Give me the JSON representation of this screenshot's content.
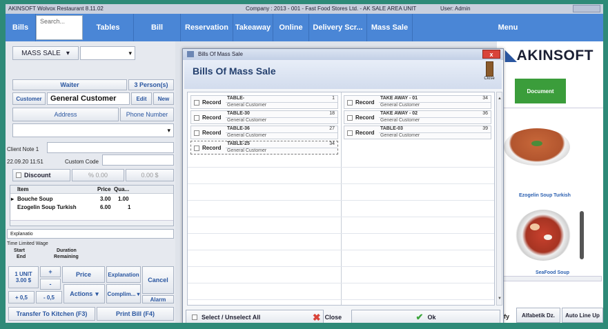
{
  "window": {
    "title": "AKINSOFT Wolvox Restaurant 8.11.02",
    "company": "Company : 2013 - 001 - Fast Food Stores Ltd.  -  AK SALE AREA UNIT",
    "user": "User: Admin"
  },
  "nav": {
    "bills": "Bills",
    "search_placeholder": "Search...",
    "tables": "Tables",
    "bill": "Bill",
    "reservation": "Reservation",
    "takeaway": "Takeaway",
    "online": "Online",
    "delivery": "Delivery Scr...",
    "mass_sale": "Mass Sale",
    "menu": "Menu"
  },
  "left": {
    "mode": "MASS SALE",
    "waiter_label": "Waiter",
    "persons": "3 Person(s)",
    "customer_btn": "Customer",
    "customer_name": "General Customer",
    "edit_btn": "Edit",
    "new_btn": "New",
    "address_btn": "Address",
    "phone_btn": "Phone Number",
    "client_note": "Client Note 1",
    "datetime": "22.09.20 11:51",
    "custom_code": "Custom Code",
    "discount_label": "Discount",
    "discount_pct": "% 0.00",
    "discount_amt": "0.00 $",
    "grid_headers": {
      "item": "Item",
      "price": "Price",
      "qty": "Qua..."
    },
    "items": [
      {
        "item": "Bouche Soup",
        "price": "3.00",
        "qty": "1.00"
      },
      {
        "item": "Ezogelin Soup Turkish",
        "price": "6.00",
        "qty": "1"
      }
    ],
    "explanation_label": "Explanatio",
    "time_limited": "Time Limited Wage",
    "start": "Start",
    "duration": "Duration",
    "end": "End",
    "remaining": "Remaining",
    "unit_btn": "1 UNIT",
    "unit_price": "3.00 $",
    "plus": "+",
    "minus": "-",
    "price_btn": "Price",
    "explanation_btn": "Explanation",
    "cancel_btn": "Cancel",
    "plus_half": "+ 0,5",
    "minus_half": "- 0,5",
    "actions_btn": "Actions",
    "compliments_btn": "Complim...",
    "alarm_btn": "Alarm",
    "transfer_btn": "Transfer To Kitchen (F3)",
    "print_btn": "Print Bill (F4)"
  },
  "dialog": {
    "window_title": "Bills Of Mass Sale",
    "title": "Bills Of Mass Sale",
    "close_label": "Close",
    "x": "x",
    "records_left": [
      {
        "label": "Record",
        "table": "TABLE-",
        "num": "1",
        "customer": "General Customer"
      },
      {
        "label": "Record",
        "table": "TABLE-30",
        "num": "18",
        "customer": "General Customer"
      },
      {
        "label": "Record",
        "table": "TABLE-36",
        "num": "27",
        "customer": "General Customer"
      },
      {
        "label": "Record",
        "table": "TABLE-25",
        "num": "34",
        "customer": "General Customer"
      }
    ],
    "records_right": [
      {
        "label": "Record",
        "table": "TAKE AWAY - 01",
        "num": "34",
        "customer": "General Customer"
      },
      {
        "label": "Record",
        "table": "TAKE AWAY - 02",
        "num": "36",
        "customer": "General Customer"
      },
      {
        "label": "Record",
        "table": "TABLE-03",
        "num": "39",
        "customer": "General Customer"
      }
    ],
    "select_all": "Select / Unselect All",
    "close_btn": "Close",
    "ok_btn": "Ok"
  },
  "right": {
    "logo": "AKINSOFT",
    "document_btn": "Document",
    "products": [
      {
        "name": "Ezogelin Soup Turkish"
      },
      {
        "name": "SeaFood Soup"
      }
    ],
    "alphabetic_btn": "Alfabetik Dz.",
    "auto_line_btn": "Auto Line Up",
    "fy": "fy"
  },
  "colors": {
    "frame": "#2e8a78",
    "nav": "#4a86d6",
    "close": "#d9443a",
    "document": "#3b9d3b"
  }
}
